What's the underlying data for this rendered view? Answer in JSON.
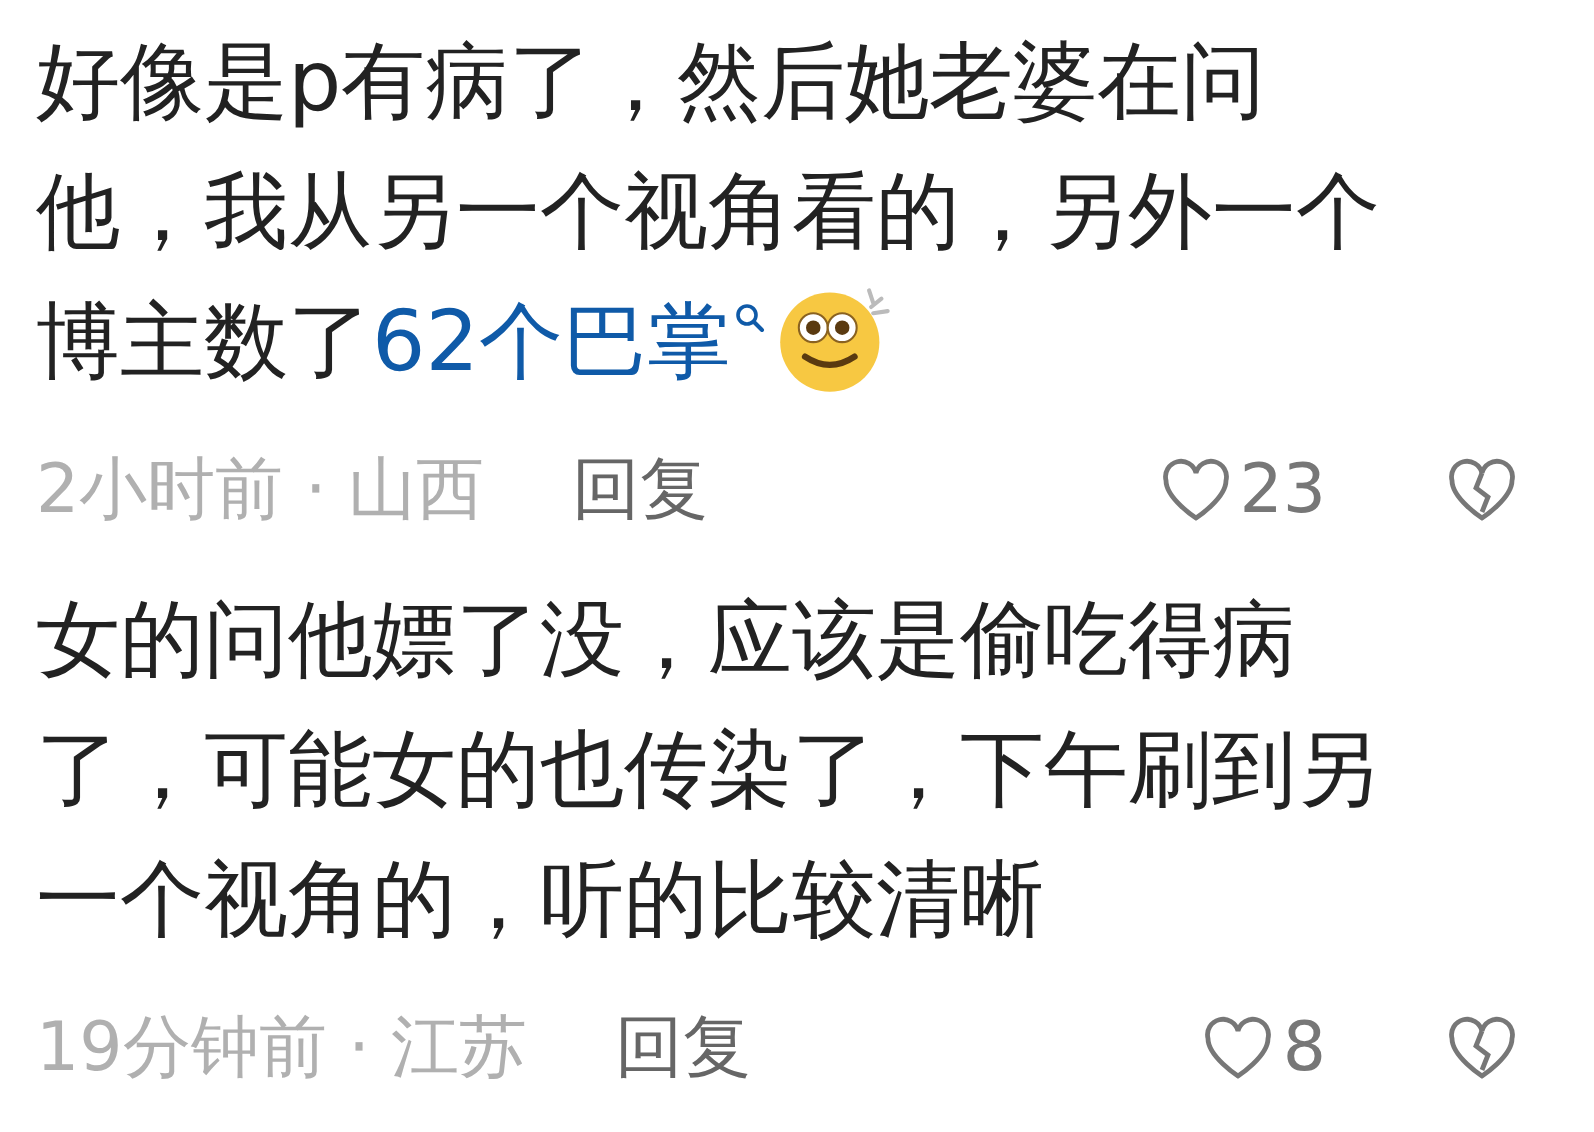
{
  "comments": [
    {
      "lines": [
        [
          {
            "kind": "text",
            "text": "好像是p有病了，然后她老婆在问"
          }
        ],
        [
          {
            "kind": "text",
            "text": "他，我从另一个视角看的，另外一个"
          }
        ],
        [
          {
            "kind": "text",
            "text": "博主数了"
          },
          {
            "kind": "link",
            "text": "62个巴掌"
          },
          {
            "kind": "emoji"
          }
        ]
      ],
      "time": "2小时前",
      "separator": "·",
      "location": "山西",
      "reply": "回复",
      "likes": "23",
      "liked": false
    },
    {
      "lines": [
        [
          {
            "kind": "text",
            "text": "女的问他嫖了没，应该是偷吃得病"
          }
        ],
        [
          {
            "kind": "text",
            "text": "了，可能女的也传染了，下午刷到另"
          }
        ],
        [
          {
            "kind": "text",
            "text": "一个视角的，听的比较清晰"
          }
        ]
      ],
      "time": "19分钟前",
      "separator": "·",
      "location": "江苏",
      "reply": "回复",
      "likes": "8",
      "liked": false
    }
  ]
}
